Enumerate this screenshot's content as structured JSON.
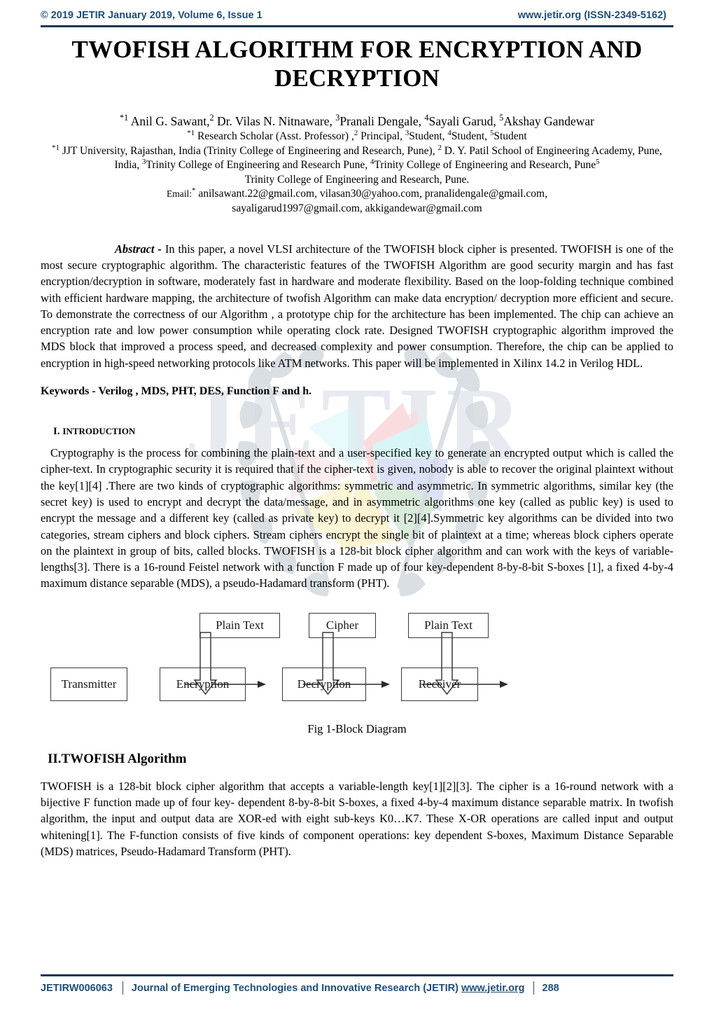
{
  "header": {
    "left": "© 2019 JETIR  January 2019, Volume 6, Issue 1",
    "right": "www.jetir.org  (ISSN-2349-5162)",
    "accent_color": "#1f4e79"
  },
  "title": "TWOFISH ALGORITHM FOR ENCRYPTION AND DECRYPTION",
  "authors": {
    "names_line": "Anil G. Sawant, Dr. Vilas N. Nitnaware, Pranali Dengale, Sayali Garud, Akshay Gandewar",
    "name_1": "Anil G. Sawant,",
    "name_2": "Dr. Vilas N. Nitnaware,",
    "name_3": "Pranali Dengale,",
    "name_4": "Sayali Garud,",
    "name_5": "Akshay Gandewar",
    "sup_star1": "*1",
    "sup_2": "2",
    "sup_3": "3",
    "sup_4": "4",
    "sup_5": "5",
    "role_1": "Research Scholar (Asst. Professor) ,",
    "role_2": "Principal,",
    "role_3": "Student,",
    "role_4": "Student,",
    "role_5": "Student",
    "affil_1": "JJT University, Rajasthan, India (Trinity College of Engineering and Research, Pune),",
    "affil_2": "D. Y. Patil School of Engineering Academy, Pune, India,",
    "affil_3": "Trinity College of Engineering and Research Pune,",
    "affil_4": "Trinity College of Engineering and Research, Pune",
    "affil_5": "Trinity College of Engineering and Research, Pune.",
    "email_label": "Email:",
    "email_sup": "*",
    "emails_line_1": "anilsawant.22@gmail.com, vilasan30@yahoo.com, pranalidengale@gmail.com,",
    "emails_line_2": "sayaligarud1997@gmail.com, akkigandewar@gmail.com"
  },
  "abstract": {
    "label": "Abstract -",
    "text": " In this paper, a novel VLSI architecture of the TWOFISH block cipher is presented. TWOFISH is one of the most secure cryptographic algorithm. The characteristic features of the TWOFISH Algorithm are good security margin and has fast encryption/decryption in software, moderately fast in hardware and moderate flexibility. Based on the loop-folding technique combined with efficient hardware mapping, the architecture of twofish Algorithm can make data encryption/ decryption more efficient and secure. To demonstrate the correctness of our Algorithm , a prototype chip for the architecture has been implemented. The chip can achieve an encryption rate and low power consumption while operating clock rate. Designed TWOFISH cryptographic algorithm improved the MDS block that improved a process speed, and decreased complexity and power consumption. Therefore, the chip can be applied to encryption in high-speed networking protocols like ATM networks. This paper will be implemented in Xilinx 14.2 in Verilog HDL."
  },
  "keywords": "Keywords - Verilog , MDS, PHT, DES, Function F and h.",
  "sections": [
    {
      "number": "I.",
      "heading": "INTRODUCTION",
      "body": " Cryptography is the process for combining the plain-text and a user-specified key to generate an encrypted output which is called the cipher-text. In cryptographic security it is required that if the cipher-text is given, nobody is able to recover the original plaintext without the key[1][4] .There are two kinds of cryptographic algorithms: symmetric and asymmetric. In symmetric algorithms, similar key (the secret key) is used to encrypt and decrypt the data/message, and in asymmetric algorithms one key (called as public key) is used to encrypt the message and a different key (called as private key) to decrypt it [2][4].Symmetric key algorithms can be divided into two categories, stream ciphers and block ciphers. Stream ciphers encrypt the single bit of plaintext at a time; whereas block ciphers operate on the plaintext in group of bits, called blocks. TWOFISH is a 128-bit block cipher algorithm and can work with the keys of variable-lengths[3]. There is a 16-round Feistel network with a function F made up of four key-dependent 8-by-8-bit S-boxes [1], a fixed 4-by-4 maximum distance separable (MDS), a pseudo-Hadamard transform (PHT)."
    },
    {
      "number": "II.",
      "heading": "II.TWOFISH Algorithm",
      "body": "TWOFISH is a 128-bit block cipher algorithm that accepts a variable-length key[1][2][3]. The cipher is a 16-round network with a bijective F function made up of four key- dependent 8-by-8-bit S-boxes, a fixed 4-by-4 maximum distance separable matrix. In twofish algorithm, the input and output data are XOR-ed with eight sub-keys K0…K7. These X-OR operations are called input and output whitening[1]. The F-function consists of five kinds of component operations: key dependent S-boxes, Maximum Distance Separable (MDS) matrices, Pseudo-Hadamard Transform (PHT)."
    }
  ],
  "figure": {
    "caption": "Fig 1-Block Diagram",
    "top_boxes": [
      {
        "label": "Plain Text"
      },
      {
        "label": "Cipher"
      },
      {
        "label": "Plain Text"
      }
    ],
    "bottom_boxes": [
      {
        "label": "Transmitter"
      },
      {
        "label": "Encryption"
      },
      {
        "label": "Decryption"
      },
      {
        "label": "Receiver"
      }
    ]
  },
  "watermark": {
    "text": "JETIR",
    "color": "#dfe4ea",
    "petal_colors": [
      "#fadadd",
      "#d6f5f7",
      "#dbe0f5",
      "#d8ecd9",
      "#fbf3cf"
    ]
  },
  "footer": {
    "code": "JETIRW006063",
    "journal": "Journal of Emerging Technologies and Innovative Research (JETIR)",
    "url": "www.jetir.org",
    "page": "288",
    "accent_color": "#1f4e79"
  }
}
